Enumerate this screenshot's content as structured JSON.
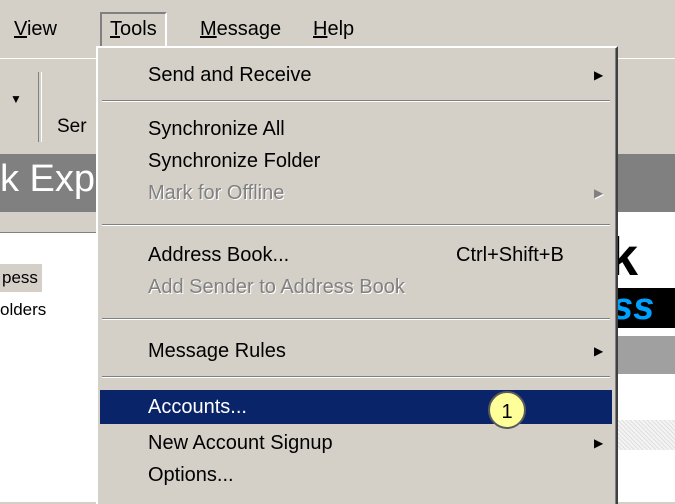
{
  "menubar": {
    "view": "View",
    "tools": "Tools",
    "message": "Message",
    "help": "Help"
  },
  "toolbar": {
    "send_label": "Ser"
  },
  "window": {
    "title_partial": "k Exp"
  },
  "folders": {
    "express": "pess",
    "folders": "olders"
  },
  "logo": {
    "k": "k",
    "ss": "ss"
  },
  "tools_menu": {
    "send_and_receive": "Send and Receive",
    "synchronize_all": "Synchronize All",
    "synchronize_folder": "Synchronize Folder",
    "mark_for_offline": "Mark for Offline",
    "address_book": "Address Book...",
    "address_book_shortcut": "Ctrl+Shift+B",
    "add_sender": "Add Sender to Address Book",
    "message_rules": "Message Rules",
    "accounts": "Accounts...",
    "new_account_signup": "New Account Signup",
    "options": "Options..."
  },
  "annotation": {
    "step": "1"
  },
  "colors": {
    "highlight": "#0a246a",
    "face": "#d4d0c8",
    "badge": "#ffff99"
  }
}
